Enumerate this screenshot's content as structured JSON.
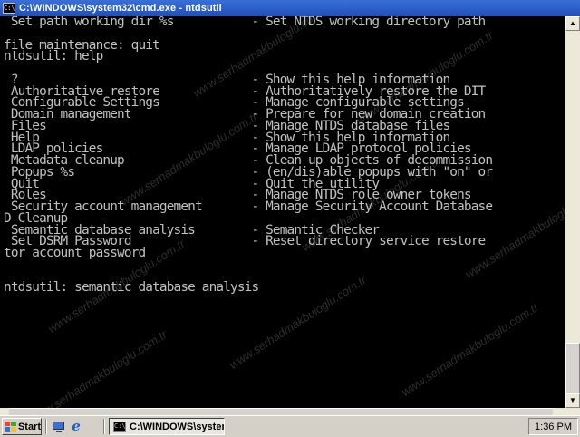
{
  "window": {
    "title": "C:\\WINDOWS\\system32\\cmd.exe - ntdsutil",
    "icon": "cmd-icon"
  },
  "console": {
    "lines": [
      " Set path working dir %s           - Set NTDS working directory path",
      "",
      "file maintenance: quit",
      "ntdsutil: help",
      "",
      " ?                                 - Show this help information",
      " Authoritative restore             - Authoritatively restore the DIT",
      " Configurable Settings             - Manage configurable settings",
      " Domain management                 - Prepare for new domain creation",
      " Files                             - Manage NTDS database files",
      " Help                              - Show this help information",
      " LDAP policies                     - Manage LDAP protocol policies",
      " Metadata cleanup                  - Clean up objects of decommission",
      " Popups %s                         - (en/dis)able popups with \"on\" or",
      " Quit                              - Quit the utility",
      " Roles                             - Manage NTDS role owner tokens",
      " Security account management       - Manage Security Account Database",
      "D Cleanup",
      " Semantic database analysis        - Semantic Checker",
      " Set DSRM Password                 - Reset directory service restore",
      "tor account password",
      "",
      "",
      "ntdsutil: semantic database analysis"
    ],
    "watermark": "www.serhadmakbuloglu.com.tr"
  },
  "taskbar": {
    "start_label": "Start",
    "task_label": "C:\\WINDOWS\\system...",
    "clock": "1:36 PM",
    "quick_launch": [
      "show-desktop-icon",
      "internet-explorer-icon"
    ]
  },
  "colors": {
    "console_bg": "#000000",
    "console_text": "#c0c0c0",
    "titlebar": "#2a5cc6",
    "taskbar": "#d4d0c8"
  }
}
